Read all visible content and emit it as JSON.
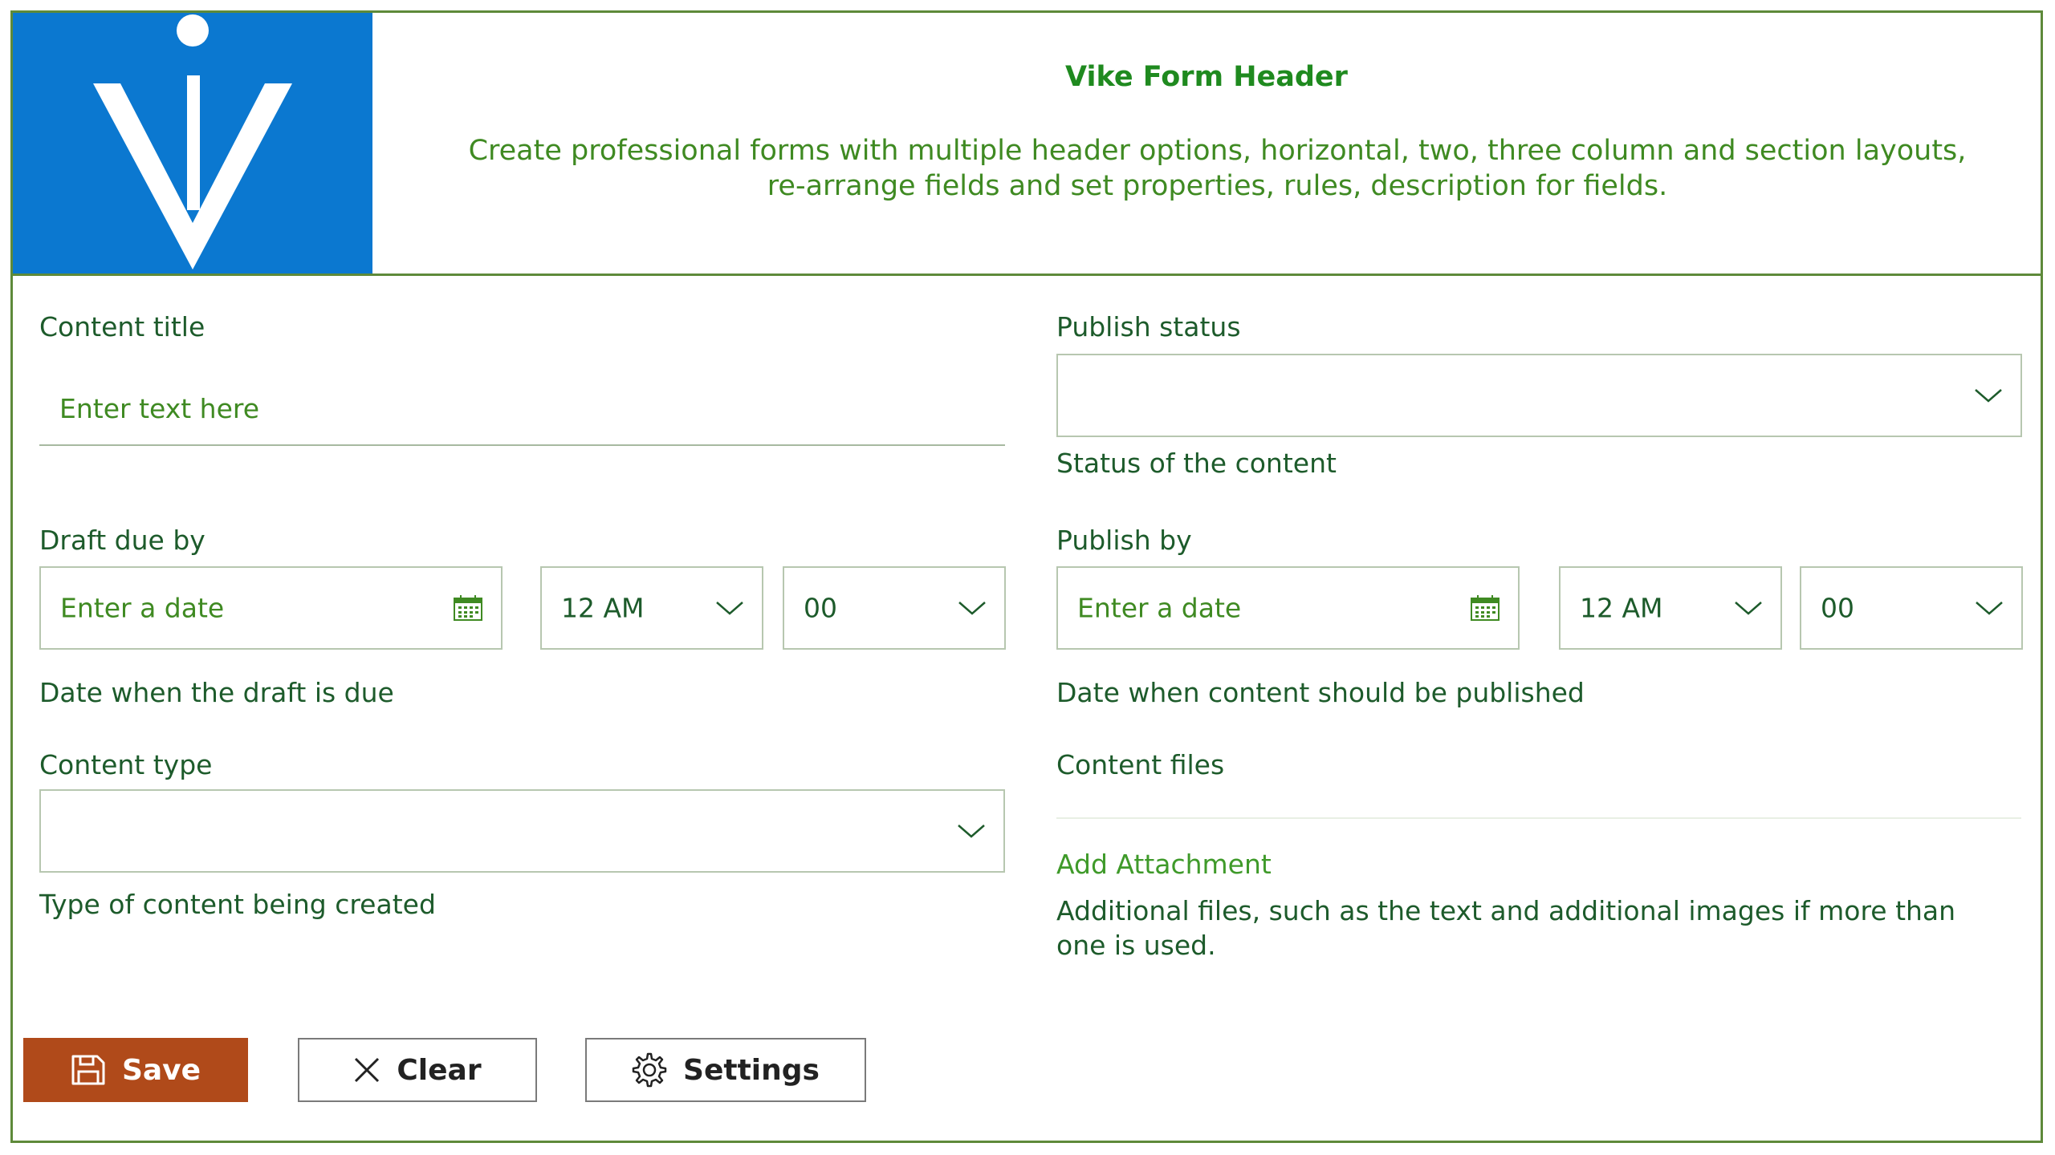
{
  "header": {
    "title": "Vike Form Header",
    "description_line1": "Create professional forms with multiple header options, horizontal, two, three column and section layouts,",
    "description_line2": "re-arrange fields and set properties, rules, description for fields."
  },
  "fields": {
    "content_title": {
      "label": "Content title",
      "placeholder": "Enter text here"
    },
    "publish_status": {
      "label": "Publish status",
      "value": "",
      "helper": "Status of the content"
    },
    "draft_due_by": {
      "label": "Draft due by",
      "date_placeholder": "Enter a date",
      "hour": "12 AM",
      "minute": "00",
      "helper": "Date when the draft is due"
    },
    "publish_by": {
      "label": "Publish by",
      "date_placeholder": "Enter a date",
      "hour": "12 AM",
      "minute": "00",
      "helper": "Date when content should be published"
    },
    "content_type": {
      "label": "Content type",
      "value": "",
      "helper": "Type of content being created"
    },
    "content_files": {
      "label": "Content files",
      "add_attachment": "Add Attachment",
      "helper_line1": "Additional files, such as the text and additional images if more than",
      "helper_line2": "one is used."
    }
  },
  "buttons": {
    "save": "Save",
    "clear": "Clear",
    "settings": "Settings"
  },
  "colors": {
    "frame": "#5e8a3a",
    "logo_bg": "#0b78d0",
    "save_bg": "#b04a1a",
    "text_green": "#1d5b2b",
    "title_green": "#1f8a1f"
  },
  "icons": {
    "logo": "vike-logo",
    "calendar": "calendar-icon",
    "chevron": "chevron-down-icon",
    "save": "save-icon",
    "clear": "close-icon",
    "settings": "gear-icon"
  }
}
